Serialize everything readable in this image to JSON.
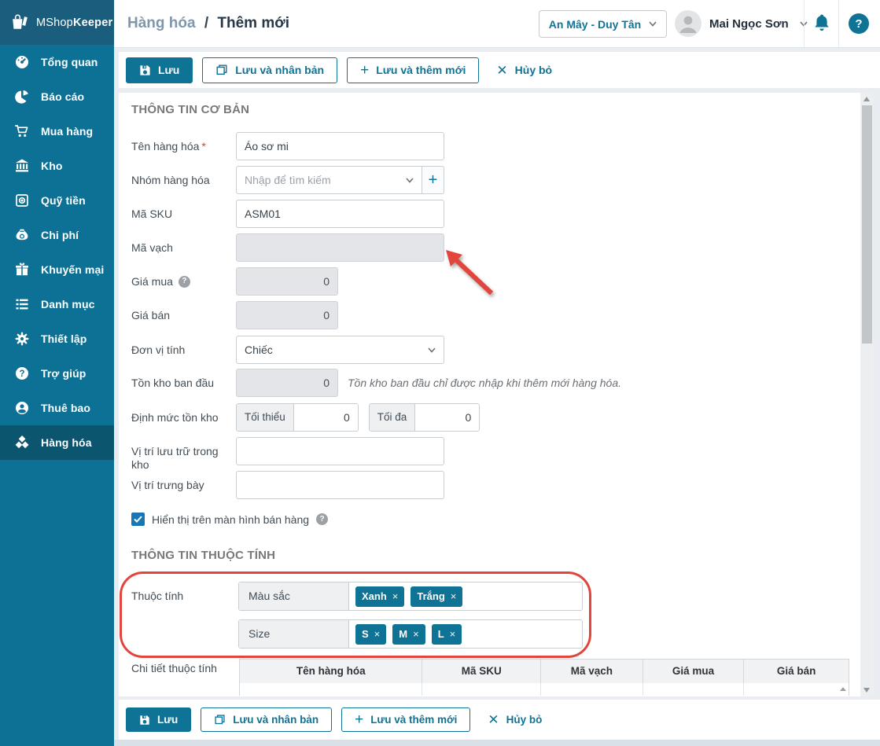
{
  "colors": {
    "accent": "#0f7396",
    "sidebar": "#0d7195",
    "sidebar_active": "#0b556f",
    "annotation_red": "#e2453c"
  },
  "brand": {
    "prefix": "MShop",
    "suffix": "Keeper"
  },
  "breadcrumb": {
    "section": "Hàng hóa",
    "separator": "/",
    "page": "Thêm mới"
  },
  "header": {
    "store": "An Mây - Duy Tân",
    "user": "Mai Ngọc Sơn"
  },
  "icons": {
    "plus_glyph": "+",
    "close_glyph": "✕",
    "remove_glyph": "×",
    "help_glyph": "?"
  },
  "sidebar": {
    "items": [
      {
        "label": "Tổng quan"
      },
      {
        "label": "Báo cáo"
      },
      {
        "label": "Mua hàng"
      },
      {
        "label": "Kho"
      },
      {
        "label": "Quỹ tiền"
      },
      {
        "label": "Chi phí"
      },
      {
        "label": "Khuyến mại"
      },
      {
        "label": "Danh mục"
      },
      {
        "label": "Thiết lập"
      },
      {
        "label": "Trợ giúp"
      },
      {
        "label": "Thuê bao"
      },
      {
        "label": "Hàng hóa"
      }
    ]
  },
  "actions": {
    "save": "Lưu",
    "save_duplicate": "Lưu và nhân bản",
    "save_new": "Lưu và thêm mới",
    "cancel": "Hủy bỏ"
  },
  "basic": {
    "title": "THÔNG TIN CƠ BẢN",
    "name_label": "Tên hàng hóa",
    "name_required": "*",
    "name_value": "Áo sơ mi",
    "group_label": "Nhóm hàng hóa",
    "group_placeholder": "Nhập để tìm kiếm",
    "sku_label": "Mã SKU",
    "sku_value": "ASM01",
    "barcode_label": "Mã vạch",
    "barcode_value": "",
    "purchase_label": "Giá mua",
    "purchase_value": "0",
    "sale_label": "Giá bán",
    "sale_value": "0",
    "unit_label": "Đơn vị tính",
    "unit_value": "Chiếc",
    "stock_label": "Tồn kho ban đầu",
    "stock_value": "0",
    "stock_note": "Tồn kho ban đầu chỉ được nhập khi thêm mới hàng hóa.",
    "limit_label": "Định mức tồn kho",
    "limit_min_label": "Tối thiểu",
    "limit_min_value": "0",
    "limit_max_label": "Tối đa",
    "limit_max_value": "0",
    "warehouse_pos_label": "Vị trí lưu trữ trong kho",
    "warehouse_pos_value": "",
    "display_pos_label": "Vị trí trưng bày",
    "display_pos_value": "",
    "show_on_pos_label": "Hiển thị trên màn hình bán hàng"
  },
  "attributes": {
    "title": "THÔNG TIN THUỘC TÍNH",
    "label": "Thuộc tính",
    "rows": [
      {
        "name": "Màu sắc",
        "tags": [
          "Xanh",
          "Trắng"
        ]
      },
      {
        "name": "Size",
        "tags": [
          "S",
          "M",
          "L"
        ]
      }
    ],
    "detail_label": "Chi tiết thuộc tính",
    "columns": [
      "Tên hàng hóa",
      "Mã SKU",
      "Mã vạch",
      "Giá mua",
      "Giá bán"
    ]
  }
}
